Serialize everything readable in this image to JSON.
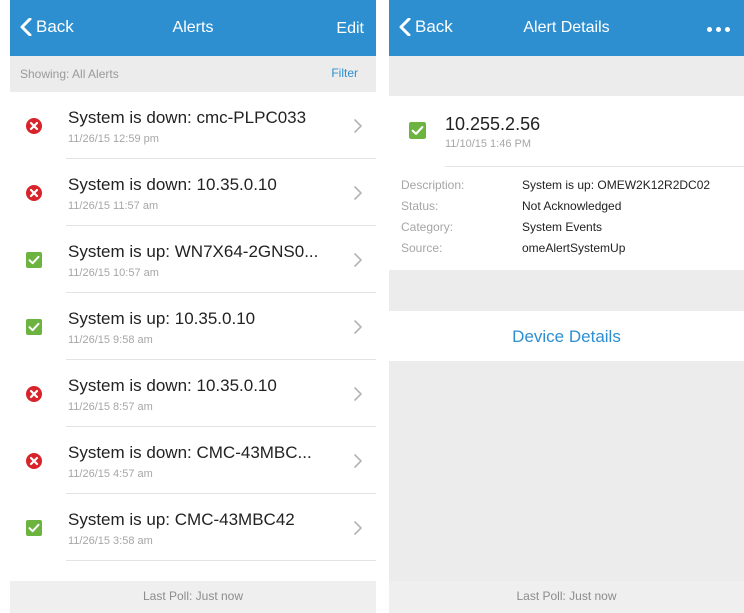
{
  "alerts_screen": {
    "back_label": "Back",
    "title": "Alerts",
    "edit_label": "Edit",
    "showing_label": "Showing: All Alerts",
    "filter_label": "Filter",
    "items": [
      {
        "status": "down",
        "title": "System is down: cmc-PLPC033",
        "time": "11/26/15 12:59 pm"
      },
      {
        "status": "down",
        "title": "System is down: 10.35.0.10",
        "time": "11/26/15 11:57 am"
      },
      {
        "status": "up",
        "title": "System is up: WN7X64-2GNS0...",
        "time": "11/26/15 10:57 am"
      },
      {
        "status": "up",
        "title": "System is up: 10.35.0.10",
        "time": "11/26/15 9:58 am"
      },
      {
        "status": "down",
        "title": "System is down: 10.35.0.10",
        "time": "11/26/15 8:57 am"
      },
      {
        "status": "down",
        "title": "System is down: CMC-43MBC...",
        "time": "11/26/15 4:57 am"
      },
      {
        "status": "up",
        "title": "System is up: CMC-43MBC42",
        "time": "11/26/15 3:58 am"
      }
    ],
    "last_poll": "Last Poll: Just now"
  },
  "details_screen": {
    "back_label": "Back",
    "title": "Alert Details",
    "status": "up",
    "ip": "10.255.2.56",
    "time": "11/10/15 1:46 PM",
    "properties": [
      {
        "label": "Description:",
        "value": "System is up: OMEW2K12R2DC02"
      },
      {
        "label": "Status:",
        "value": "Not Acknowledged"
      },
      {
        "label": "Category:",
        "value": "System Events"
      },
      {
        "label": "Source:",
        "value": "omeAlertSystemUp"
      }
    ],
    "device_details_label": "Device Details",
    "last_poll": "Last Poll: Just now"
  },
  "colors": {
    "nav_blue": "#2d8fd0",
    "status_down": "#d8232a",
    "status_up": "#6cb33f"
  },
  "icons": {
    "down": "error-x-circle-icon",
    "up": "checkbox-checked-icon",
    "row": "chevron-right-icon",
    "back": "chevron-left-icon",
    "more": "more-dots-icon"
  }
}
